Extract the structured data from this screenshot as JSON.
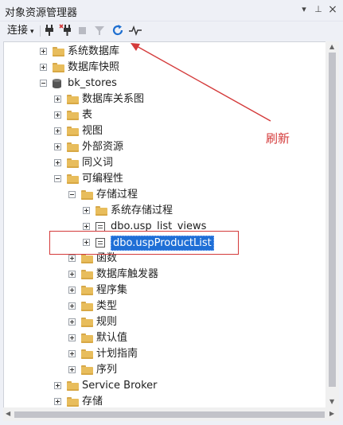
{
  "window": {
    "title": "对象资源管理器"
  },
  "title_buttons": {
    "dropdown_icon": "▾",
    "pin_icon": "⊥",
    "close_icon": "×"
  },
  "toolbar": {
    "connect_label": "连接",
    "connect_arrow": "▾"
  },
  "tree": [
    {
      "id": "sysdb",
      "label": "系统数据库",
      "depth": 2,
      "expander": "plus",
      "icon": "folder"
    },
    {
      "id": "snap",
      "label": "数据库快照",
      "depth": 2,
      "expander": "plus",
      "icon": "folder"
    },
    {
      "id": "bk",
      "label": "bk_stores",
      "depth": 2,
      "expander": "minus",
      "icon": "database"
    },
    {
      "id": "diag",
      "label": "数据库关系图",
      "depth": 3,
      "expander": "plus",
      "icon": "folder"
    },
    {
      "id": "tables",
      "label": "表",
      "depth": 3,
      "expander": "plus",
      "icon": "folder"
    },
    {
      "id": "views",
      "label": "视图",
      "depth": 3,
      "expander": "plus",
      "icon": "folder"
    },
    {
      "id": "ext",
      "label": "外部资源",
      "depth": 3,
      "expander": "plus",
      "icon": "folder"
    },
    {
      "id": "syn",
      "label": "同义词",
      "depth": 3,
      "expander": "plus",
      "icon": "folder"
    },
    {
      "id": "prog",
      "label": "可编程性",
      "depth": 3,
      "expander": "minus",
      "icon": "folder"
    },
    {
      "id": "sp",
      "label": "存储过程",
      "depth": 4,
      "expander": "minus",
      "icon": "folder"
    },
    {
      "id": "syssp",
      "label": "系统存储过程",
      "depth": 5,
      "expander": "plus",
      "icon": "folder"
    },
    {
      "id": "usp1",
      "label": "dbo.usp_list_views",
      "depth": 5,
      "expander": "plus",
      "icon": "procedure"
    },
    {
      "id": "usp2",
      "label": "dbo.uspProductList",
      "depth": 5,
      "expander": "plus",
      "icon": "procedure",
      "selected": true
    },
    {
      "id": "func",
      "label": "函数",
      "depth": 4,
      "expander": "plus",
      "icon": "folder"
    },
    {
      "id": "trig",
      "label": "数据库触发器",
      "depth": 4,
      "expander": "plus",
      "icon": "folder"
    },
    {
      "id": "asm",
      "label": "程序集",
      "depth": 4,
      "expander": "plus",
      "icon": "folder"
    },
    {
      "id": "types",
      "label": "类型",
      "depth": 4,
      "expander": "plus",
      "icon": "folder"
    },
    {
      "id": "rules",
      "label": "规则",
      "depth": 4,
      "expander": "plus",
      "icon": "folder"
    },
    {
      "id": "defs",
      "label": "默认值",
      "depth": 4,
      "expander": "plus",
      "icon": "folder"
    },
    {
      "id": "plan",
      "label": "计划指南",
      "depth": 4,
      "expander": "plus",
      "icon": "folder"
    },
    {
      "id": "seq",
      "label": "序列",
      "depth": 4,
      "expander": "plus",
      "icon": "folder"
    },
    {
      "id": "sb",
      "label": "Service Broker",
      "depth": 3,
      "expander": "plus",
      "icon": "folder"
    },
    {
      "id": "stor",
      "label": "存储",
      "depth": 3,
      "expander": "plus",
      "icon": "folder"
    }
  ],
  "annotation": {
    "text": "刷新",
    "color": "#d43a3a"
  },
  "colors": {
    "selection": "#1f6fd6",
    "folder": "#e8bd5c",
    "refresh": "#1e6fd0"
  }
}
